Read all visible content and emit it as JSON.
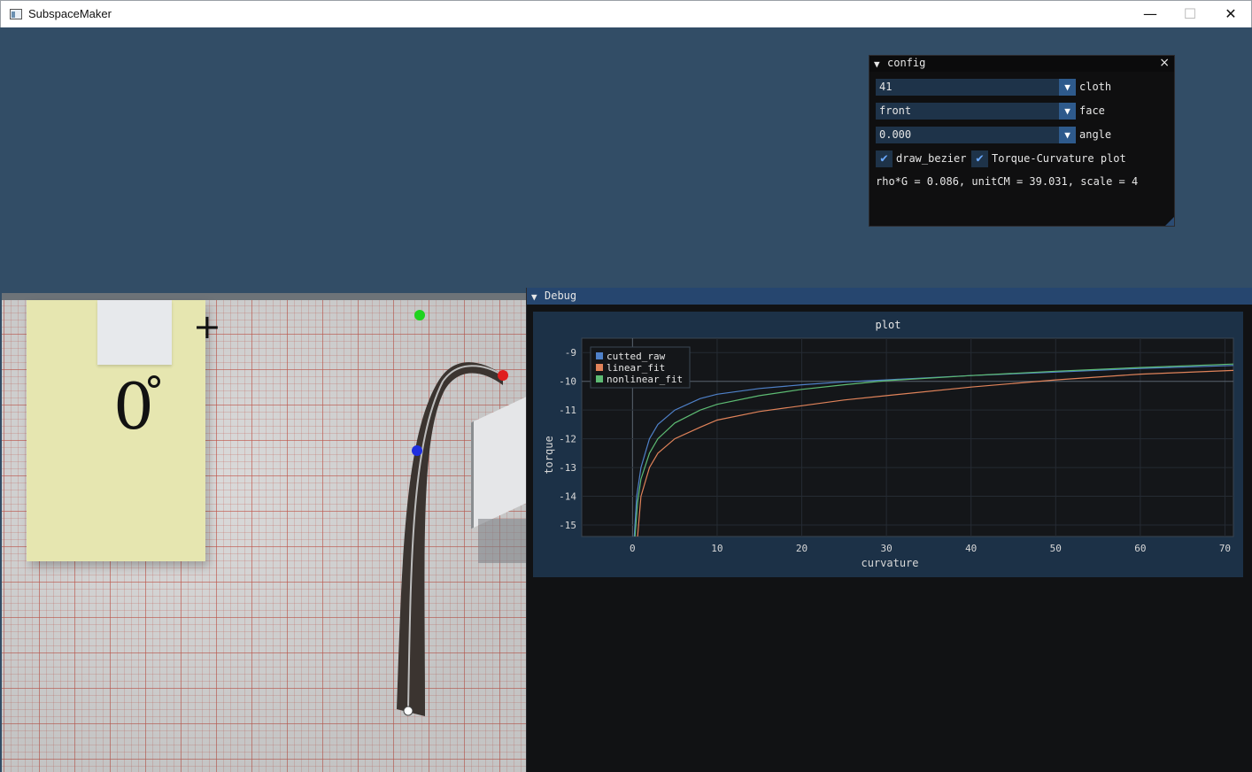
{
  "window": {
    "title": "SubspaceMaker",
    "minimize": "—",
    "maximize": "☐",
    "close": "✕"
  },
  "photo": {
    "note_text": "0",
    "note_plus": "+"
  },
  "config": {
    "title": "config",
    "close": "×",
    "cloth": {
      "value": "41",
      "label": "cloth"
    },
    "face": {
      "value": "front",
      "label": "face"
    },
    "angle": {
      "value": "0.000",
      "label": "angle"
    },
    "draw_bezier": {
      "checked": true,
      "label": "draw_bezier"
    },
    "torque_plot": {
      "checked": true,
      "label": "Torque-Curvature plot"
    },
    "info": "rho*G = 0.086, unitCM = 39.031, scale = 4"
  },
  "debug": {
    "title": "Debug"
  },
  "chart_data": {
    "type": "line",
    "title": "plot",
    "xlabel": "curvature",
    "ylabel": "torque",
    "xlim": [
      -6,
      71
    ],
    "ylim": [
      -15.4,
      -8.5
    ],
    "xticks": [
      0,
      10,
      20,
      30,
      40,
      50,
      60,
      70
    ],
    "yticks": [
      -9,
      -10,
      -11,
      -12,
      -13,
      -14,
      -15
    ],
    "legend_position": "top-left",
    "series": [
      {
        "name": "cutted_raw",
        "color": "#4f81c9",
        "x": [
          0.2,
          0.5,
          1,
          2,
          3,
          5,
          8,
          10,
          15,
          20,
          25,
          30,
          40,
          50,
          60,
          71
        ],
        "y": [
          -15.4,
          -14.0,
          -13.0,
          -12.0,
          -11.5,
          -11.0,
          -10.6,
          -10.45,
          -10.25,
          -10.12,
          -10.02,
          -9.95,
          -9.8,
          -9.68,
          -9.55,
          -9.45
        ]
      },
      {
        "name": "linear_fit",
        "color": "#e0835a",
        "x": [
          0.6,
          1,
          2,
          3,
          5,
          8,
          10,
          15,
          20,
          25,
          30,
          40,
          50,
          60,
          71
        ],
        "y": [
          -15.4,
          -14.0,
          -13.0,
          -12.5,
          -12.0,
          -11.6,
          -11.35,
          -11.05,
          -10.85,
          -10.65,
          -10.5,
          -10.2,
          -9.95,
          -9.75,
          -9.62
        ]
      },
      {
        "name": "nonlinear_fit",
        "color": "#5dbb73",
        "x": [
          0.3,
          0.6,
          1,
          2,
          3,
          5,
          8,
          10,
          15,
          20,
          25,
          30,
          40,
          50,
          60,
          71
        ],
        "y": [
          -15.4,
          -14.2,
          -13.4,
          -12.5,
          -12.0,
          -11.45,
          -11.0,
          -10.8,
          -10.5,
          -10.28,
          -10.12,
          -9.98,
          -9.8,
          -9.65,
          -9.52,
          -9.4
        ]
      }
    ]
  }
}
